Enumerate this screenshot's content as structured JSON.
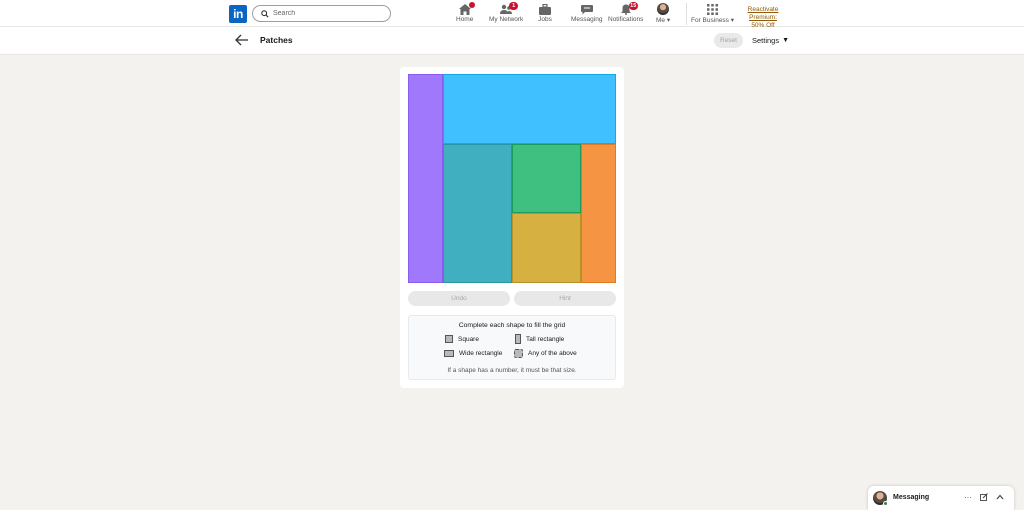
{
  "topnav": {
    "logo_text": "in",
    "search_placeholder": "Search",
    "items": [
      {
        "label": "Home",
        "icon": "home-icon",
        "badge": ""
      },
      {
        "label": "My Network",
        "icon": "network-icon",
        "badge": "1"
      },
      {
        "label": "Jobs",
        "icon": "briefcase-icon",
        "badge": ""
      },
      {
        "label": "Messaging",
        "icon": "chat-icon",
        "badge": ""
      },
      {
        "label": "Notifications",
        "icon": "bell-icon",
        "badge": "15"
      },
      {
        "label": "Me",
        "icon": "avatar",
        "badge": ""
      },
      {
        "label": "For Business",
        "icon": "grid-icon",
        "badge": ""
      }
    ],
    "premium_line1": "Reactivate Premium:",
    "premium_line2": "50% Off"
  },
  "subheader": {
    "title": "Patches",
    "reset_label": "Reset",
    "settings_label": "Settings"
  },
  "board": {
    "grid_size": 6,
    "regions": [
      {
        "name": "purple",
        "color": "#a078fb",
        "border": "#8a5df0"
      },
      {
        "name": "sky",
        "color": "#40c0ff",
        "border": "#1aa7ea"
      },
      {
        "name": "teal",
        "color": "#40b0c0",
        "border": "#2a96a5"
      },
      {
        "name": "green",
        "color": "#40c080",
        "border": "#1f9a5e"
      },
      {
        "name": "orange",
        "color": "#f59443",
        "border": "#e07a22"
      },
      {
        "name": "gold",
        "color": "#d6b040",
        "border": "#b89228"
      }
    ]
  },
  "controls": {
    "undo_label": "Undo",
    "hint_label": "Hint"
  },
  "legend": {
    "title": "Complete each shape to fill the grid",
    "square": "Square",
    "tall": "Tall rectangle",
    "wide": "Wide rectangle",
    "any": "Any of the above",
    "note": "If a shape has a number, it must be that size."
  },
  "messaging": {
    "label": "Messaging"
  }
}
